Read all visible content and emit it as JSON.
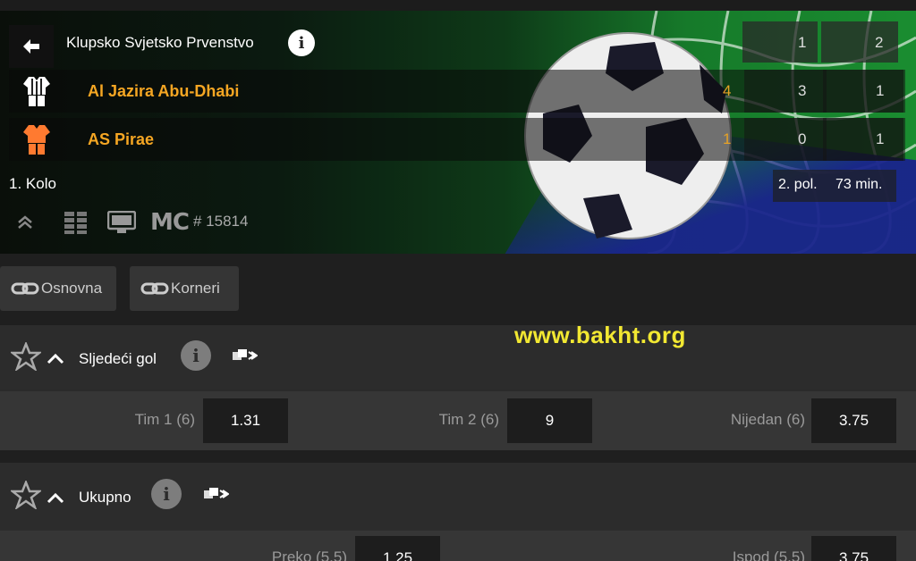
{
  "header": {
    "league_title": "Klupsko Svjetsko Prvenstvo",
    "col_labels": [
      "1",
      "2"
    ],
    "teams": [
      {
        "name": "Al Jazira Abu-Dhabi",
        "current": "4",
        "half1": "3",
        "half2": "1"
      },
      {
        "name": "AS Pirae",
        "current": "1",
        "half1": "0",
        "half2": "1"
      }
    ],
    "round": "1. Kolo",
    "period": "2. pol.",
    "minute": "73 min.",
    "match_id": "# 15814",
    "mc_label": "MC"
  },
  "tabs": [
    "Osnovna",
    "Korneri"
  ],
  "watermark": "www.bakht.org",
  "markets": [
    {
      "title": "Sljedeći gol",
      "outcomes": [
        {
          "label": "Tim 1 (6)",
          "odd": "1.31"
        },
        {
          "label": "Tim 2 (6)",
          "odd": "9"
        },
        {
          "label": "Nijedan (6)",
          "odd": "3.75"
        }
      ]
    },
    {
      "title": "Ukupno",
      "outcomes": [
        {
          "label": "Preko (5.5)",
          "odd": "1.25"
        },
        {
          "label": "Ispod (5.5)",
          "odd": "3.75"
        }
      ]
    }
  ],
  "colors": {
    "accent": "#f5a623",
    "watermark": "#f2e832",
    "background": "#2b2b2b"
  }
}
